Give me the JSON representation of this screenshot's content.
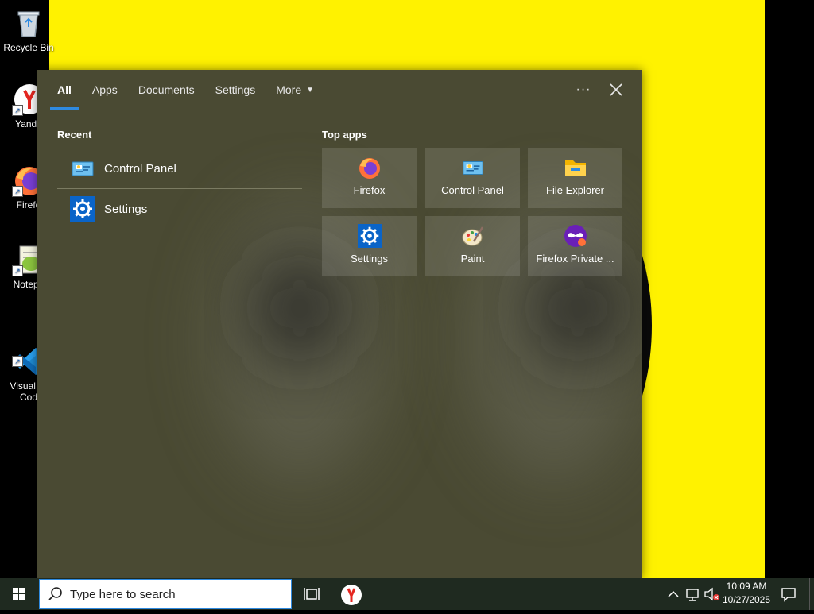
{
  "desktop": {
    "icons": [
      {
        "label": "Recycle Bin",
        "icon": "recycle-bin-icon"
      },
      {
        "label": "Yande",
        "icon": "yandex-browser-icon"
      },
      {
        "label": "Firefo",
        "icon": "firefox-icon"
      },
      {
        "label": "Notepa",
        "icon": "notepad-plus-plus-icon"
      },
      {
        "label": "Visual St\nCod",
        "icon": "vscode-icon"
      }
    ]
  },
  "search_panel": {
    "tabs": [
      {
        "label": "All",
        "active": true
      },
      {
        "label": "Apps"
      },
      {
        "label": "Documents"
      },
      {
        "label": "Settings"
      },
      {
        "label": "More"
      }
    ],
    "more_options_label": "···",
    "recent": {
      "title": "Recent",
      "items": [
        {
          "label": "Control Panel",
          "icon": "control-panel-icon"
        },
        {
          "label": "Settings",
          "icon": "settings-gear-icon"
        }
      ]
    },
    "top_apps": {
      "title": "Top apps",
      "items": [
        {
          "label": "Firefox",
          "icon": "firefox-icon"
        },
        {
          "label": "Control Panel",
          "icon": "control-panel-icon"
        },
        {
          "label": "File Explorer",
          "icon": "file-explorer-icon"
        },
        {
          "label": "Settings",
          "icon": "settings-gear-icon"
        },
        {
          "label": "Paint",
          "icon": "paint-icon"
        },
        {
          "label": "Firefox Private ...",
          "icon": "firefox-private-icon"
        }
      ]
    }
  },
  "taskbar": {
    "search_placeholder": "Type here to search",
    "clock_time": "10:09 AM",
    "clock_date": "10/27/2025"
  },
  "colors": {
    "accent": "#2f8ae0",
    "wallpaper": "#fff200",
    "panel": "#4a4a33"
  }
}
